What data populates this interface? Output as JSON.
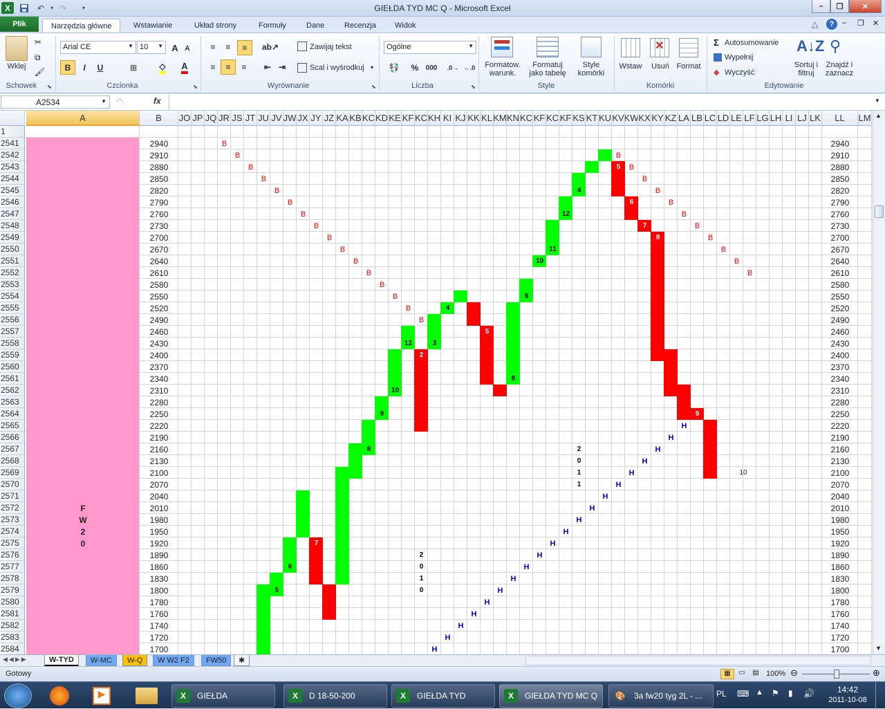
{
  "window": {
    "title": "GIEŁDA TYD MC Q  -  Microsoft Excel",
    "minimize": "–",
    "maximize": "❐",
    "close": "✕"
  },
  "quick_access": {
    "save_icon": "save-icon",
    "undo_icon": "undo-icon",
    "redo_icon": "redo-icon"
  },
  "ribbon_tabs": {
    "file": "Plik",
    "items": [
      "Narzędzia główne",
      "Wstawianie",
      "Układ strony",
      "Formuły",
      "Dane",
      "Recenzja",
      "Widok"
    ]
  },
  "ribbon": {
    "clipboard": {
      "label": "Schowek",
      "paste": "Wklej"
    },
    "font": {
      "label": "Czcionka",
      "name": "Arial CE",
      "size": "10",
      "bold": "B",
      "italic": "I",
      "underline": "U",
      "grow": "A",
      "shrink": "A"
    },
    "alignment": {
      "label": "Wyrównanie",
      "wrap": "Zawijaj tekst",
      "merge": "Scal i wyśrodkuj"
    },
    "number": {
      "label": "Liczba",
      "format": "Ogólne",
      "percent": "%",
      "thousands": "000"
    },
    "styles": {
      "label": "Style",
      "conditional": "Formatow. warunk.",
      "table": "Formatuj jako tabelę",
      "cell_styles": "Style komórki"
    },
    "cells": {
      "label": "Komórki",
      "insert": "Wstaw",
      "delete": "Usuń",
      "format": "Format"
    },
    "editing": {
      "label": "Edytowanie",
      "autosum": "Autosumowanie",
      "fill": "Wypełnij",
      "clear": "Wyczyść",
      "sort": "Sortuj i filtruj",
      "find": "Znajdź i zaznacz"
    }
  },
  "formula_bar": {
    "name_box": "A2534",
    "fx": "fx",
    "formula": ""
  },
  "columns": [
    "A",
    "B",
    "JO",
    "JP",
    "JQ",
    "JR",
    "JS",
    "JT",
    "JU",
    "JV",
    "JW",
    "JX",
    "JY",
    "JZ",
    "KA",
    "KB",
    "KC",
    "KD",
    "KE",
    "KF",
    "KG",
    "KH",
    "KI",
    "KJ",
    "KK",
    "KL",
    "KM",
    "KN",
    "KO",
    "KP",
    "KQ",
    "KR",
    "KS",
    "KT",
    "KU",
    "KV",
    "KW",
    "KX",
    "KY",
    "KZ",
    "LA",
    "LB",
    "LC",
    "LD",
    "LE",
    "LF",
    "LG",
    "LH",
    "LI",
    "LJ",
    "LK",
    "LL",
    "LM"
  ],
  "col_header_labels": [
    "A",
    "B",
    "JO",
    "JP",
    "JQ",
    "JR",
    "JS",
    "JT",
    "JU",
    "JV",
    "JW",
    "JX",
    "JY",
    "JZ",
    "KA",
    "KB",
    "KC",
    "KD",
    "KE",
    "KF",
    "KC",
    "KH",
    "KI",
    "KJ",
    "KK",
    "KL",
    "KM",
    "KN",
    "KC",
    "KF",
    "KC",
    "KF",
    "KS",
    "KT",
    "KU",
    "KV",
    "KW",
    "KX",
    "KY",
    "KZ",
    "LA",
    "LB",
    "LC",
    "LD",
    "LE",
    "LF",
    "LG",
    "LH",
    "LI",
    "LJ",
    "LK",
    "LL",
    "LM"
  ],
  "rows": [
    {
      "n": "1",
      "price": ""
    },
    {
      "n": "2541",
      "price": "2940"
    },
    {
      "n": "2542",
      "price": "2910"
    },
    {
      "n": "2543",
      "price": "2880"
    },
    {
      "n": "2544",
      "price": "2850"
    },
    {
      "n": "2545",
      "price": "2820"
    },
    {
      "n": "2546",
      "price": "2790"
    },
    {
      "n": "2547",
      "price": "2760"
    },
    {
      "n": "2548",
      "price": "2730"
    },
    {
      "n": "2549",
      "price": "2700"
    },
    {
      "n": "2550",
      "price": "2670"
    },
    {
      "n": "2551",
      "price": "2640"
    },
    {
      "n": "2552",
      "price": "2610"
    },
    {
      "n": "2553",
      "price": "2580"
    },
    {
      "n": "2554",
      "price": "2550"
    },
    {
      "n": "2555",
      "price": "2520"
    },
    {
      "n": "2556",
      "price": "2490"
    },
    {
      "n": "2557",
      "price": "2460"
    },
    {
      "n": "2558",
      "price": "2430"
    },
    {
      "n": "2559",
      "price": "2400"
    },
    {
      "n": "2560",
      "price": "2370"
    },
    {
      "n": "2561",
      "price": "2340"
    },
    {
      "n": "2562",
      "price": "2310"
    },
    {
      "n": "2563",
      "price": "2280"
    },
    {
      "n": "2564",
      "price": "2250"
    },
    {
      "n": "2565",
      "price": "2220"
    },
    {
      "n": "2566",
      "price": "2190"
    },
    {
      "n": "2567",
      "price": "2160"
    },
    {
      "n": "2568",
      "price": "2130"
    },
    {
      "n": "2569",
      "price": "2100"
    },
    {
      "n": "2570",
      "price": "2070"
    },
    {
      "n": "2571",
      "price": "2040"
    },
    {
      "n": "2572",
      "price": "2010"
    },
    {
      "n": "2573",
      "price": "1980"
    },
    {
      "n": "2574",
      "price": "1950"
    },
    {
      "n": "2575",
      "price": "1920"
    },
    {
      "n": "2576",
      "price": "1890"
    },
    {
      "n": "2577",
      "price": "1860"
    },
    {
      "n": "2578",
      "price": "1830"
    },
    {
      "n": "2579",
      "price": "1800"
    },
    {
      "n": "2580",
      "price": "1780"
    },
    {
      "n": "2581",
      "price": "1760"
    },
    {
      "n": "2582",
      "price": "1740"
    },
    {
      "n": "2583",
      "price": "1720"
    },
    {
      "n": "2584",
      "price": "1700"
    }
  ],
  "column_a_text": {
    "2572": "F",
    "2573": "W",
    "2574": "2",
    "2575": "0"
  },
  "chart_marks": {
    "green_bars": [
      {
        "col": "JU",
        "from": "2579",
        "to": "2584"
      },
      {
        "col": "JV",
        "from": "2578",
        "to": "2579",
        "label": "5"
      },
      {
        "col": "JW",
        "from": "2575",
        "to": "2577",
        "label": "6"
      },
      {
        "col": "JX",
        "from": "2571",
        "to": "2574"
      },
      {
        "col": "KA",
        "from": "2569",
        "to": "2578"
      },
      {
        "col": "KB",
        "from": "2567",
        "to": "2569"
      },
      {
        "col": "KC",
        "from": "2565",
        "to": "2567",
        "label": "8"
      },
      {
        "col": "KD",
        "from": "2563",
        "to": "2564",
        "label": "9"
      },
      {
        "col": "KE",
        "from": "2559",
        "to": "2562",
        "label": "10"
      },
      {
        "col": "KF",
        "from": "2557",
        "to": "2558",
        "label": "12"
      },
      {
        "col": "KH",
        "from": "2556",
        "to": "2558",
        "label": "3"
      },
      {
        "col": "KI",
        "from": "2555",
        "to": "2555",
        "label": "4"
      },
      {
        "col": "KJ",
        "from": "2554",
        "to": "2554"
      },
      {
        "col": "KN",
        "from": "2555",
        "to": "2561",
        "label": "8"
      },
      {
        "col": "KO",
        "from": "2553",
        "to": "2554",
        "label": "9"
      },
      {
        "col": "KP",
        "from": "2551",
        "to": "2551",
        "label": "10"
      },
      {
        "col": "KQ",
        "from": "2548",
        "to": "2550",
        "label": "11"
      },
      {
        "col": "KR",
        "from": "2546",
        "to": "2547",
        "label": "12"
      },
      {
        "col": "KS",
        "from": "2544",
        "to": "2545",
        "label": "4"
      },
      {
        "col": "KT",
        "from": "2543",
        "to": "2543"
      },
      {
        "col": "KU",
        "from": "2542",
        "to": "2542"
      }
    ],
    "red_bars": [
      {
        "col": "JY",
        "from": "2575",
        "to": "2578",
        "label": "7"
      },
      {
        "col": "JZ",
        "from": "2579",
        "to": "2581"
      },
      {
        "col": "KG",
        "from": "2559",
        "to": "2565",
        "label": "2"
      },
      {
        "col": "KK",
        "from": "2555",
        "to": "2556"
      },
      {
        "col": "KL",
        "from": "2557",
        "to": "2561",
        "label": "5"
      },
      {
        "col": "KM",
        "from": "2562",
        "to": "2562"
      },
      {
        "col": "KV",
        "from": "2543",
        "to": "2545",
        "label": "5"
      },
      {
        "col": "KW",
        "from": "2546",
        "to": "2547",
        "label": "6"
      },
      {
        "col": "KX",
        "from": "2548",
        "to": "2548",
        "label": "7"
      },
      {
        "col": "KY",
        "from": "2549",
        "to": "2559",
        "label": "8"
      },
      {
        "col": "KZ",
        "from": "2559",
        "to": "2562"
      },
      {
        "col": "LA",
        "from": "2562",
        "to": "2564"
      },
      {
        "col": "LB",
        "from": "2564",
        "to": "2564",
        "label": "9"
      },
      {
        "col": "LC",
        "from": "2565",
        "to": "2569"
      }
    ],
    "b_marks": [
      {
        "col": "JR",
        "row": "2541"
      },
      {
        "col": "JS",
        "row": "2542"
      },
      {
        "col": "JT",
        "row": "2543"
      },
      {
        "col": "JU",
        "row": "2544"
      },
      {
        "col": "JV",
        "row": "2545"
      },
      {
        "col": "JW",
        "row": "2546"
      },
      {
        "col": "JX",
        "row": "2547"
      },
      {
        "col": "JY",
        "row": "2548"
      },
      {
        "col": "JZ",
        "row": "2549"
      },
      {
        "col": "KA",
        "row": "2550"
      },
      {
        "col": "KB",
        "row": "2551"
      },
      {
        "col": "KC",
        "row": "2552"
      },
      {
        "col": "KD",
        "row": "2553"
      },
      {
        "col": "KE",
        "row": "2554"
      },
      {
        "col": "KF",
        "row": "2555"
      },
      {
        "col": "KG",
        "row": "2556"
      },
      {
        "col": "KV",
        "row": "2542"
      },
      {
        "col": "KW",
        "row": "2543"
      },
      {
        "col": "KX",
        "row": "2544"
      },
      {
        "col": "KY",
        "row": "2545"
      },
      {
        "col": "KZ",
        "row": "2546"
      },
      {
        "col": "LA",
        "row": "2547"
      },
      {
        "col": "LB",
        "row": "2548"
      },
      {
        "col": "LC",
        "row": "2549"
      },
      {
        "col": "LD",
        "row": "2550"
      },
      {
        "col": "LE",
        "row": "2551"
      },
      {
        "col": "LF",
        "row": "2552"
      }
    ],
    "b_char": "B",
    "h_marks": [
      {
        "col": "KH",
        "row": "2584"
      },
      {
        "col": "KI",
        "row": "2583"
      },
      {
        "col": "KJ",
        "row": "2582"
      },
      {
        "col": "KK",
        "row": "2581"
      },
      {
        "col": "KL",
        "row": "2580"
      },
      {
        "col": "KM",
        "row": "2579"
      },
      {
        "col": "KN",
        "row": "2578"
      },
      {
        "col": "KO",
        "row": "2577"
      },
      {
        "col": "KP",
        "row": "2576"
      },
      {
        "col": "KQ",
        "row": "2575"
      },
      {
        "col": "KR",
        "row": "2574"
      },
      {
        "col": "KS",
        "row": "2573"
      },
      {
        "col": "KT",
        "row": "2572"
      },
      {
        "col": "KU",
        "row": "2571"
      },
      {
        "col": "KV",
        "row": "2570"
      },
      {
        "col": "KW",
        "row": "2569"
      },
      {
        "col": "KX",
        "row": "2568"
      },
      {
        "col": "KY",
        "row": "2567"
      },
      {
        "col": "KZ",
        "row": "2566"
      },
      {
        "col": "LA",
        "row": "2565"
      }
    ],
    "h_char": "H",
    "year_labels": [
      {
        "col": "KG",
        "rows": [
          "2576",
          "2577",
          "2578",
          "2579"
        ],
        "chars": [
          "2",
          "0",
          "1",
          "0"
        ]
      },
      {
        "col": "KS",
        "rows": [
          "2567",
          "2568",
          "2569",
          "2570"
        ],
        "chars": [
          "2",
          "0",
          "1",
          "1"
        ]
      }
    ],
    "other_labels": [
      {
        "col": "LE",
        "row": "2569",
        "text": "10"
      }
    ]
  },
  "sheet_tabs": [
    {
      "label": "W-TYD",
      "color": "#ffffff",
      "active": true
    },
    {
      "label": "W-MC",
      "color": "#6fa8f5",
      "active": false
    },
    {
      "label": "W-Q",
      "color": "#ffc000",
      "active": false
    },
    {
      "label": "W W2 F2",
      "color": "#6fa8f5",
      "active": false
    },
    {
      "label": "FW50",
      "color": "#6fa8f5",
      "active": false
    }
  ],
  "status": {
    "ready": "Gotowy",
    "zoom": "100%"
  },
  "taskbar": {
    "items": [
      {
        "label": "GIEŁDA",
        "active": false
      },
      {
        "label": "D 18-50-200",
        "active": false
      },
      {
        "label": "GIEŁDA TYD",
        "active": false
      },
      {
        "label": "GIEŁDA TYD MC Q",
        "active": true
      },
      {
        "label": "3a fw20 tyg 2L - ...",
        "active": false
      }
    ],
    "lang": "PL",
    "time": "14:42",
    "date": "2011-10-08"
  }
}
